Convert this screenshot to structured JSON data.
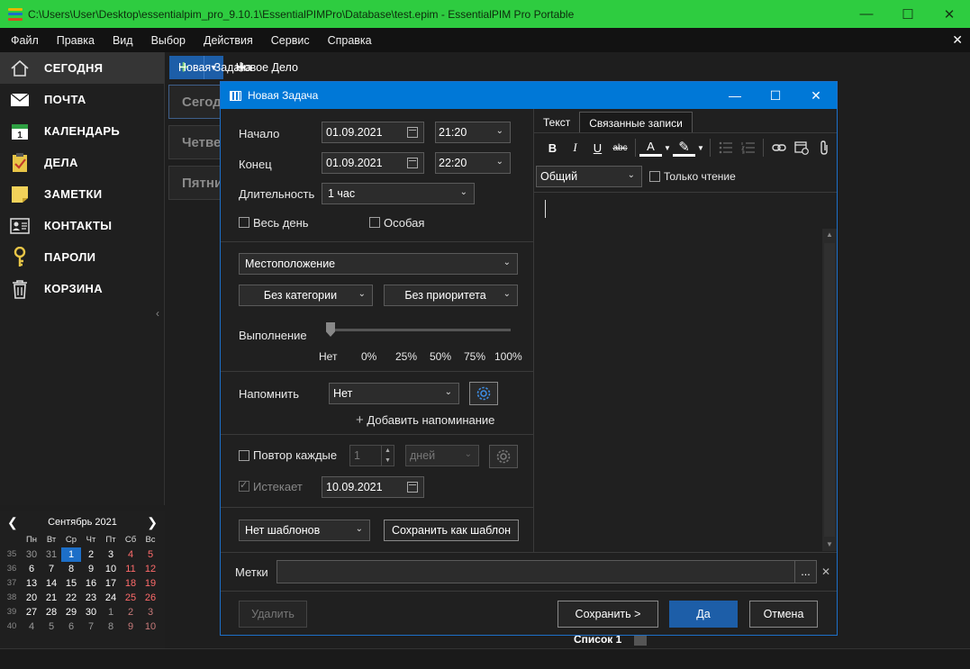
{
  "window": {
    "title": "C:\\Users\\User\\Desktop\\essentialpim_pro_9.10.1\\EssentialPIMPro\\Database\\test.epim - EssentialPIM Pro Portable",
    "minimize": "—",
    "maximize": "☐",
    "close": "✕"
  },
  "menu": {
    "items": [
      "Файл",
      "Правка",
      "Вид",
      "Выбор",
      "Действия",
      "Сервис",
      "Справка"
    ],
    "close": "✕"
  },
  "sidebar": {
    "items": [
      {
        "label": "СЕГОДНЯ",
        "icon": "home-icon"
      },
      {
        "label": "ПОЧТА",
        "icon": "mail-icon"
      },
      {
        "label": "КАЛЕНДАРЬ",
        "icon": "calendar-icon"
      },
      {
        "label": "ДЕЛА",
        "icon": "tasks-icon"
      },
      {
        "label": "ЗАМЕТКИ",
        "icon": "notes-icon"
      },
      {
        "label": "КОНТАКТЫ",
        "icon": "contacts-icon"
      },
      {
        "label": "ПАРОЛИ",
        "icon": "key-icon"
      },
      {
        "label": "КОРЗИНА",
        "icon": "trash-icon"
      }
    ],
    "collapse": "‹"
  },
  "minical": {
    "title": "Сентябрь  2021",
    "prev": "❮",
    "next": "❯",
    "daynames": [
      "Пн",
      "Вт",
      "Ср",
      "Чт",
      "Пт",
      "Сб",
      "Вс"
    ],
    "weeks": [
      {
        "wk": "35",
        "days": [
          "30",
          "31",
          "1",
          "2",
          "3",
          "4",
          "5"
        ]
      },
      {
        "wk": "36",
        "days": [
          "6",
          "7",
          "8",
          "9",
          "10",
          "11",
          "12"
        ]
      },
      {
        "wk": "37",
        "days": [
          "13",
          "14",
          "15",
          "16",
          "17",
          "18",
          "19"
        ]
      },
      {
        "wk": "38",
        "days": [
          "20",
          "21",
          "22",
          "23",
          "24",
          "25",
          "26"
        ]
      },
      {
        "wk": "39",
        "days": [
          "27",
          "28",
          "29",
          "30",
          "1",
          "2",
          "3"
        ]
      },
      {
        "wk": "40",
        "days": [
          "4",
          "5",
          "6",
          "7",
          "8",
          "9",
          "10"
        ]
      }
    ]
  },
  "toolbar": {
    "new_task": "Новая Задача",
    "new_case": "Новое Дело"
  },
  "background": {
    "cards": [
      "Сегодня",
      "Четверг",
      "Пятница"
    ],
    "list_label": "Список 1"
  },
  "dialog": {
    "title": "Новая Задача",
    "start_label": "Начало",
    "start_date": "01.09.2021",
    "start_time": "21:20",
    "end_label": "Конец",
    "end_date": "01.09.2021",
    "end_time": "22:20",
    "duration_label": "Длительность",
    "duration_value": "1 час",
    "allday_label": "Весь день",
    "special_label": "Особая",
    "location": "Местоположение",
    "category": "Без категории",
    "priority": "Без приоритета",
    "progress_label": "Выполнение",
    "progress_ticks": [
      "Нет",
      "0%",
      "25%",
      "50%",
      "75%",
      "100%"
    ],
    "progress_value": "Нет",
    "remind_label": "Напомнить",
    "remind_value": "Нет",
    "add_reminder": "Добавить напоминание",
    "repeat_label": "Повтор каждые",
    "repeat_value": "1",
    "repeat_unit": "дней",
    "expires_label": "Истекает",
    "expires_date": "10.09.2021",
    "templates": "Нет шаблонов",
    "save_template": "Сохранить как шаблон",
    "tags_label": "Метки",
    "tags_value": "",
    "tags_more": "...",
    "tags_clear": "✕",
    "btn_delete": "Удалить",
    "btn_save": "Сохранить >",
    "btn_ok": "Да",
    "btn_cancel": "Отмена",
    "tab_text": "Текст",
    "tab_related": "Связанные записи",
    "style_value": "Общий",
    "readonly_label": "Только чтение",
    "fmt": {
      "bold": "B",
      "italic": "I",
      "underline": "U",
      "strike": "abc",
      "font_color": "A",
      "highlight": "✎"
    }
  }
}
